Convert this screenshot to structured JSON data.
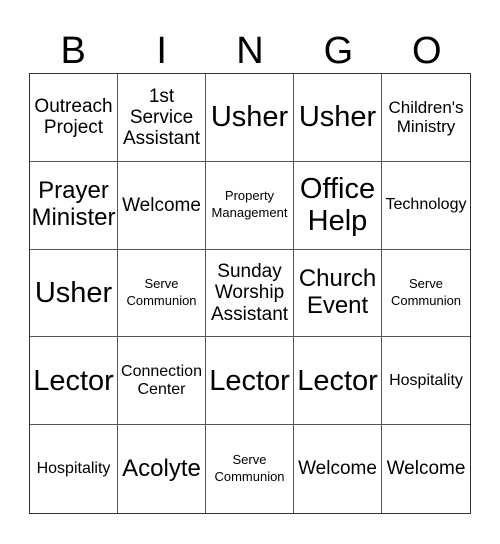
{
  "card": {
    "header_letters": [
      "B",
      "I",
      "N",
      "G",
      "O"
    ],
    "rows": [
      [
        {
          "text": "Outreach Project",
          "size": "md"
        },
        {
          "text": "1st Service Assistant",
          "size": "md"
        },
        {
          "text": "Usher",
          "size": "xl"
        },
        {
          "text": "Usher",
          "size": "xl"
        },
        {
          "text": "Children's Ministry",
          "size": "sm"
        }
      ],
      [
        {
          "text": "Prayer Minister",
          "size": "lg"
        },
        {
          "text": "Welcome",
          "size": "md"
        },
        {
          "text": "Property Management",
          "size": "xxs"
        },
        {
          "text": "Office Help",
          "size": "xl"
        },
        {
          "text": "Technology",
          "size": "xs"
        }
      ],
      [
        {
          "text": "Usher",
          "size": "xl"
        },
        {
          "text": "Serve Communion",
          "size": "xxs"
        },
        {
          "text": "Sunday Worship Assistant",
          "size": "md"
        },
        {
          "text": "Church Event",
          "size": "lg"
        },
        {
          "text": "Serve Communion",
          "size": "xxs"
        }
      ],
      [
        {
          "text": "Lector",
          "size": "xl"
        },
        {
          "text": "Connection Center",
          "size": "xs"
        },
        {
          "text": "Lector",
          "size": "xl"
        },
        {
          "text": "Lector",
          "size": "xl"
        },
        {
          "text": "Hospitality",
          "size": "xs"
        }
      ],
      [
        {
          "text": "Hospitality",
          "size": "xs"
        },
        {
          "text": "Acolyte",
          "size": "lg"
        },
        {
          "text": "Serve Communion",
          "size": "xxs"
        },
        {
          "text": "Welcome",
          "size": "md"
        },
        {
          "text": "Welcome",
          "size": "md"
        }
      ]
    ]
  }
}
